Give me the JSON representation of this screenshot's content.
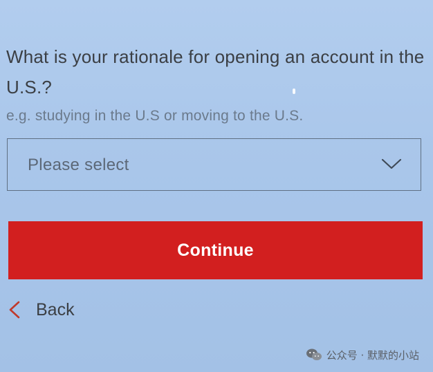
{
  "form": {
    "question": "What is your rationale for opening an account in the U.S.?",
    "hint": "e.g. studying in the U.S or moving to the U.S.",
    "select": {
      "value": "Please select",
      "icon": "chevron-down-icon"
    },
    "continue_label": "Continue",
    "back_label": "Back",
    "back_icon": "chevron-left-icon"
  },
  "watermark": {
    "text": "公众号 · 默默的小站",
    "icon": "wechat-icon"
  },
  "colors": {
    "background": "#a9c6ea",
    "primary_button": "#d21f1f",
    "back_chevron": "#c0392b",
    "text": "#3b3f44",
    "hint_text": "#6b7a8c",
    "border": "#5f6f82"
  }
}
